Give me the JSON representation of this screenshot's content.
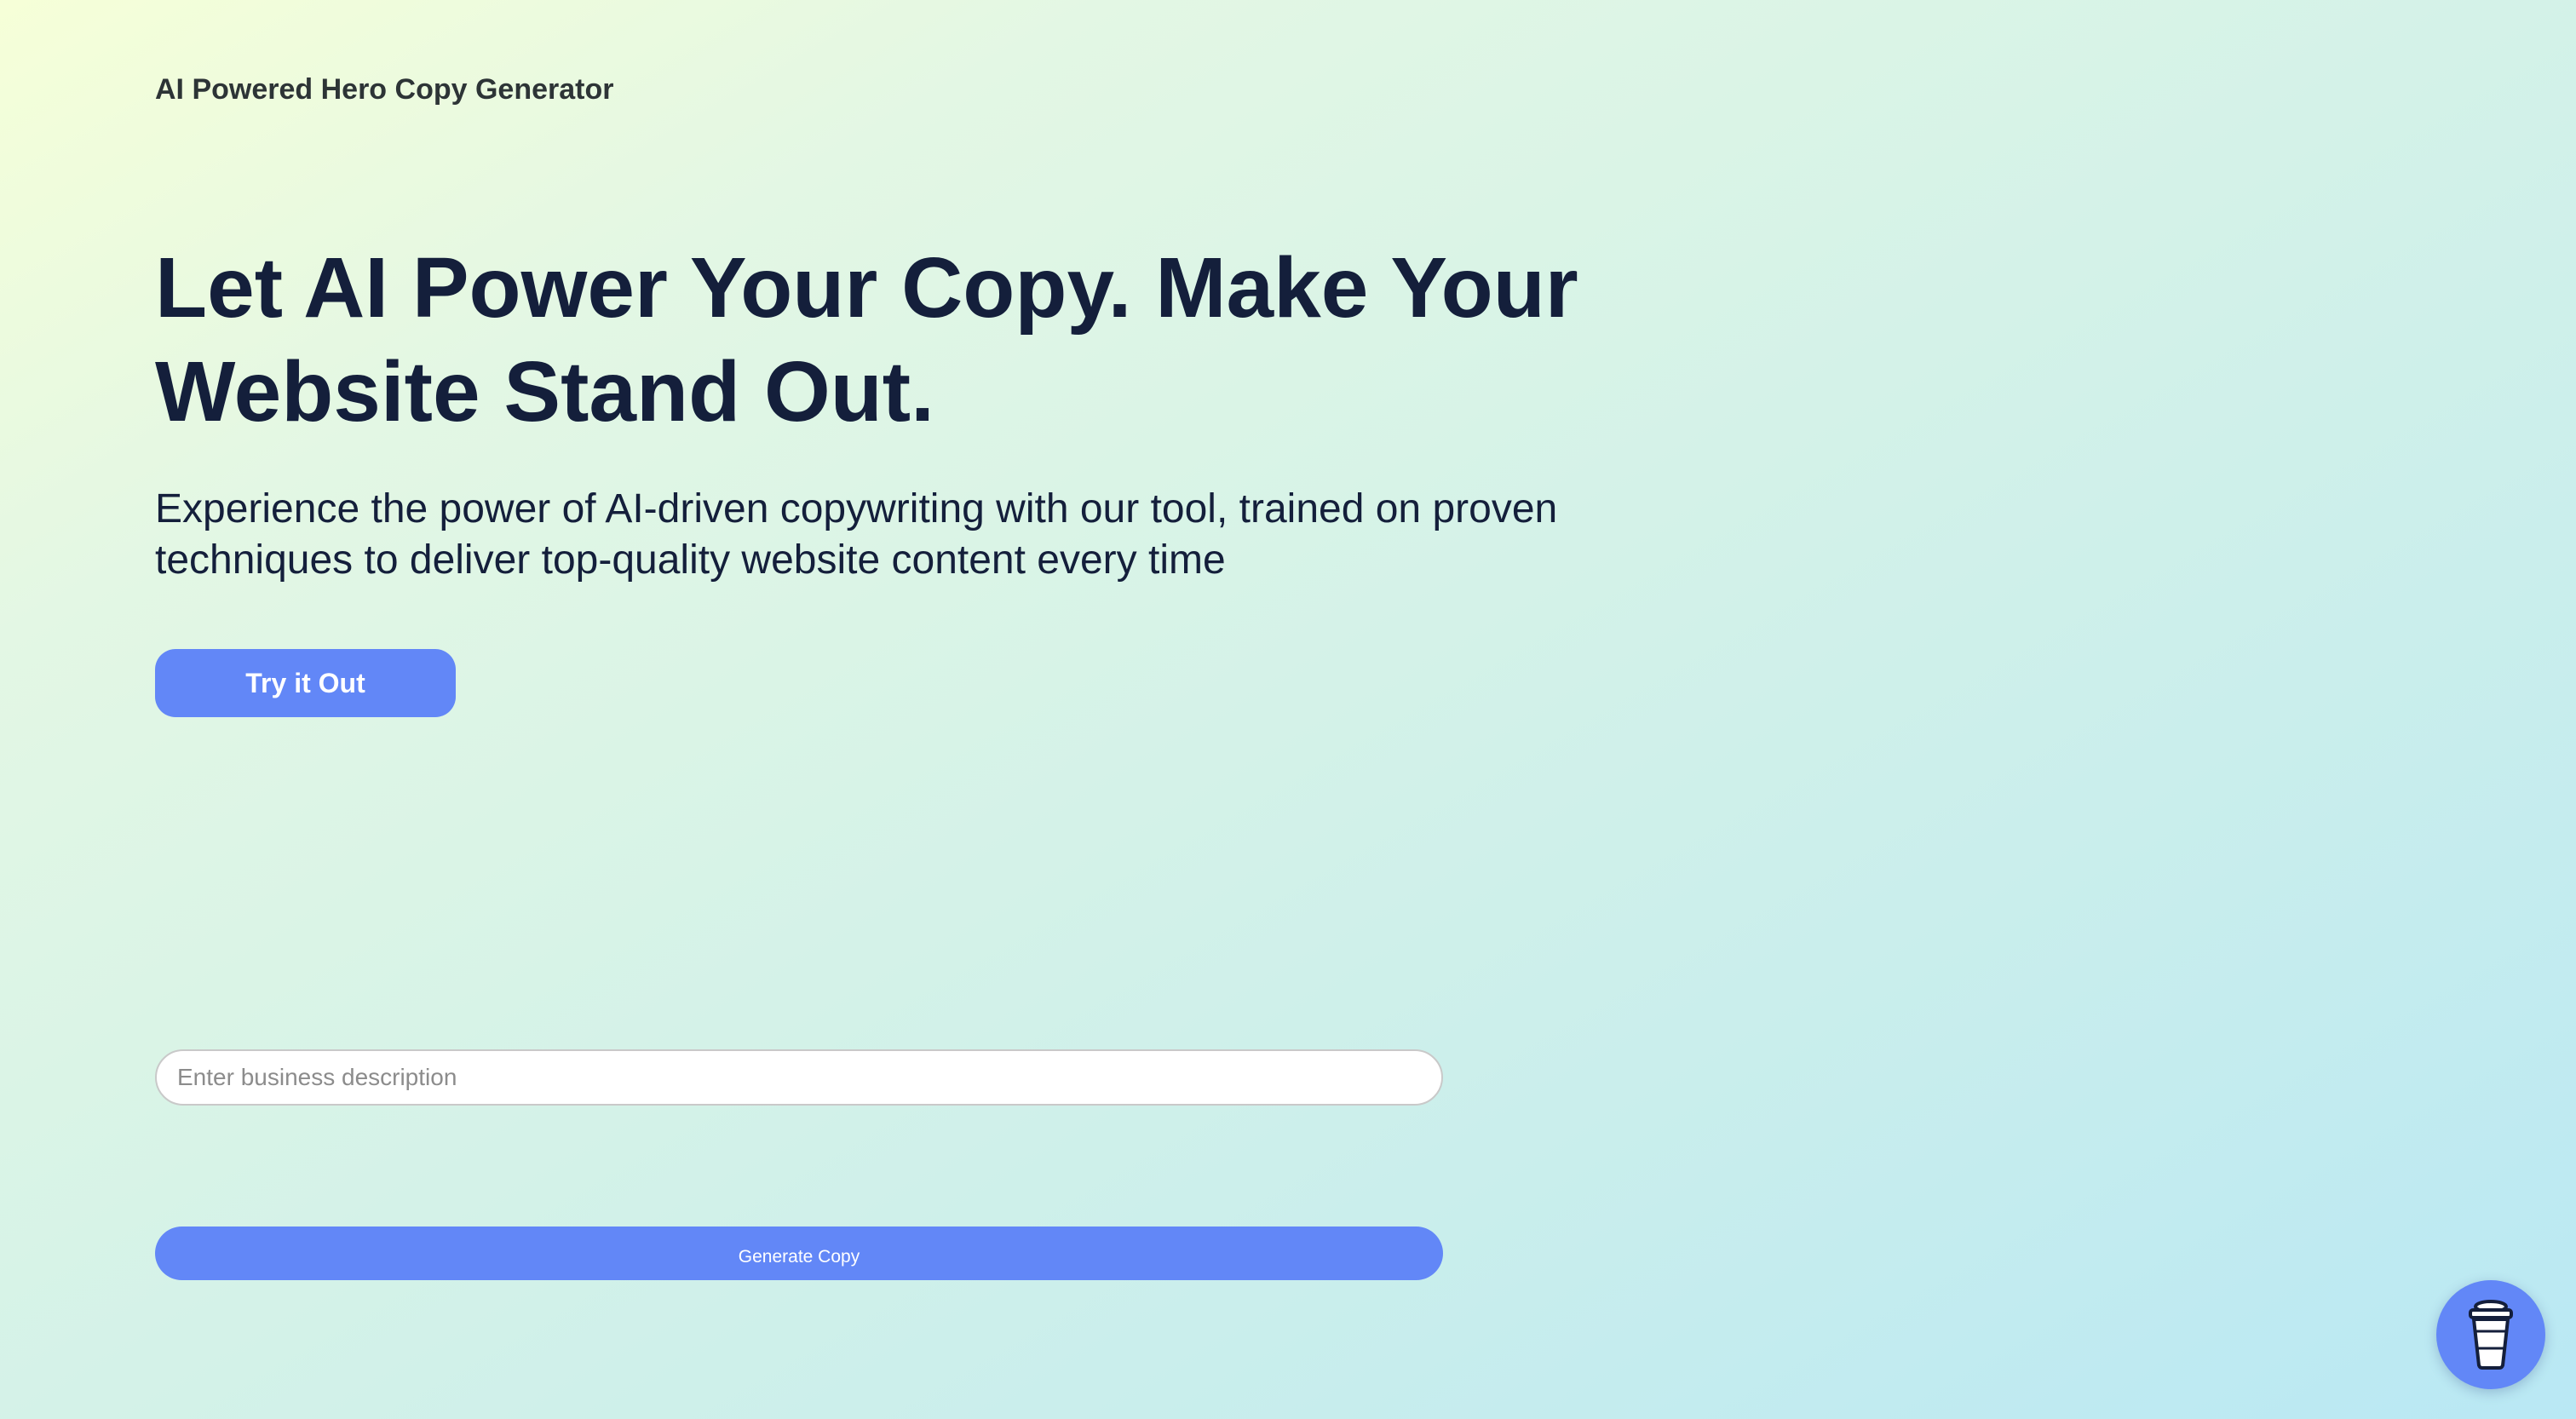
{
  "header": {
    "brand": "AI Powered Hero Copy Generator"
  },
  "hero": {
    "headline": "Let AI Power Your Copy. Make Your Website Stand Out.",
    "subtext": "Experience the power of AI-driven copywriting with our tool, trained on proven techniques to deliver top-quality website content every time",
    "cta_label": "Try it Out"
  },
  "form": {
    "input_placeholder": "Enter business description",
    "input_value": "",
    "submit_label": "Generate Copy"
  },
  "floating_widget": {
    "icon": "coffee-cup-icon"
  },
  "colors": {
    "accent": "#6287f7",
    "heading": "#141f3b",
    "brand_text": "#2d3436",
    "gradient_start": "#f6ffd8",
    "gradient_end": "#b9e8f4"
  }
}
